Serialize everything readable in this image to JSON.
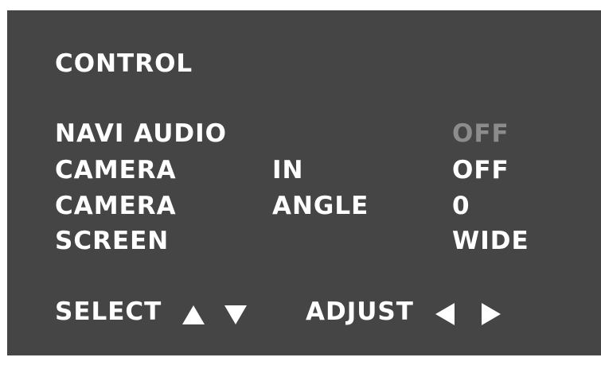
{
  "menu": {
    "title": "CONTROL",
    "items": [
      {
        "label": "NAVI AUDIO",
        "param": "",
        "value": "OFF",
        "dimmed": true
      },
      {
        "label": "CAMERA",
        "param": "IN",
        "value": "OFF",
        "dimmed": false
      },
      {
        "label": "CAMERA",
        "param": "ANGLE",
        "value": "0",
        "dimmed": false
      },
      {
        "label": "SCREEN",
        "param": "",
        "value": "WIDE",
        "dimmed": false
      }
    ]
  },
  "footer": {
    "select_label": "SELECT",
    "select_icons": [
      "arrow-up-icon",
      "arrow-down-icon"
    ],
    "adjust_label": "ADJUST",
    "adjust_icons": [
      "arrow-left-icon",
      "arrow-right-icon"
    ]
  },
  "colors": {
    "background": "#454545",
    "text": "#ffffff",
    "dimmed_text": "#8c8c8c"
  }
}
